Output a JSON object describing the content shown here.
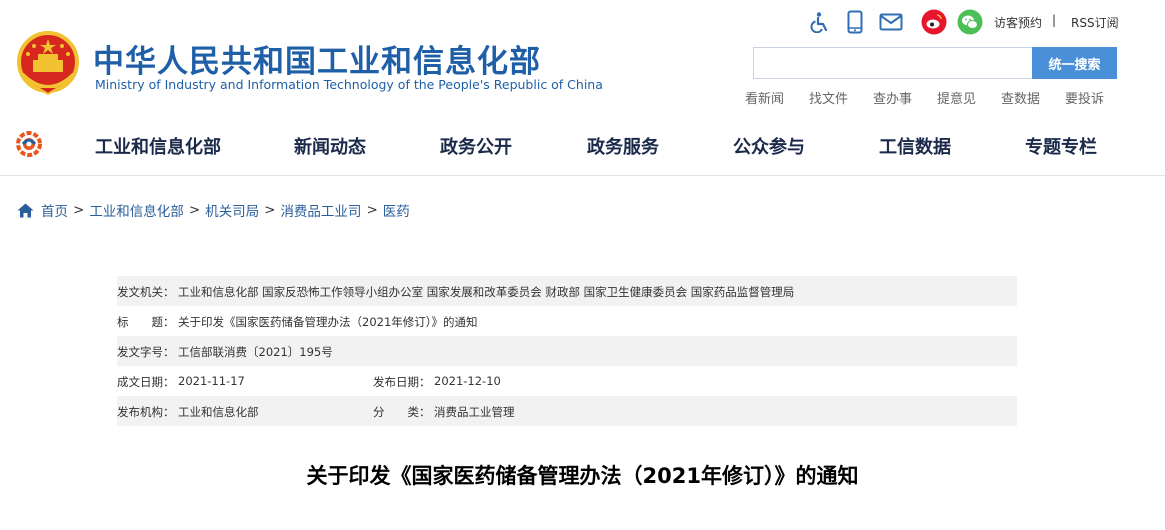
{
  "header": {
    "title": "中华人民共和国工业和信息化部",
    "subtitle": "Ministry of Industry and Information Technology of the People's Republic of China",
    "top_links": {
      "appointment": "访客预约",
      "separator": "|",
      "rss": "RSS订阅"
    },
    "icons": [
      "accessibility-icon",
      "mobile-icon",
      "email-icon",
      "weibo-icon",
      "wechat-icon"
    ],
    "search": {
      "value": "",
      "placeholder": "",
      "button_label": "统一搜索"
    },
    "quick_links": [
      "看新闻",
      "找文件",
      "查办事",
      "提意见",
      "查数据",
      "要投诉"
    ]
  },
  "nav": {
    "items": [
      "工业和信息化部",
      "新闻动态",
      "政务公开",
      "政务服务",
      "公众参与",
      "工信数据",
      "专题专栏"
    ]
  },
  "breadcrumb": {
    "items": [
      "首页",
      "工业和信息化部",
      "机关司局",
      "消费品工业司",
      "医药"
    ],
    "separator": ">"
  },
  "info": {
    "issuer_label": "发文机关：",
    "issuer_value": "工业和信息化部 国家反恐怖工作领导小组办公室 国家发展和改革委员会 财政部 国家卫生健康委员会 国家药品监督管理局",
    "title_label": "标　　题：",
    "title_value": "关于印发《国家医药储备管理办法（2021年修订）》的通知",
    "docno_label": "发文字号：",
    "docno_value": "工信部联消费〔2021〕195号",
    "created_label": "成文日期：",
    "created_value": "2021-11-17",
    "published_label": "发布日期：",
    "published_value": "2021-12-10",
    "org_label": "发布机构：",
    "org_value": "工业和信息化部",
    "category_label": "分　　类：",
    "category_value": "消费品工业管理"
  },
  "article": {
    "title": "关于印发《国家医药储备管理办法（2021年修订）》的通知"
  },
  "colors": {
    "brand_blue": "#1f5fa8",
    "search_button": "#4a90d9",
    "nav_text": "#1b2a4a",
    "emblem_red": "#d6281f",
    "emblem_gold": "#f2c230",
    "weibo": "#e6162d",
    "wechat": "#4cbf57"
  }
}
